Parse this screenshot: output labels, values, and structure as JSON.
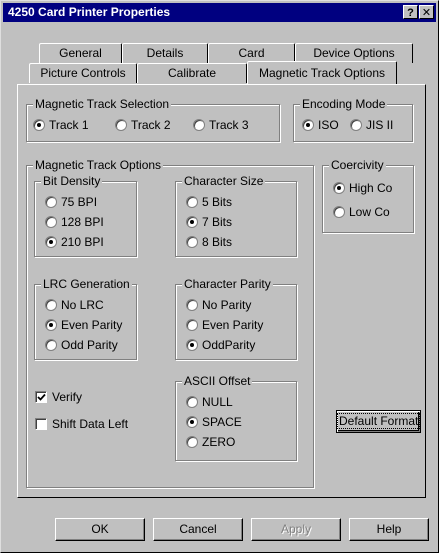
{
  "window": {
    "title": "4250 Card Printer Properties",
    "help_glyph": "?",
    "close_glyph": "✕"
  },
  "tabs_row_back": [
    {
      "label": "General"
    },
    {
      "label": "Details"
    },
    {
      "label": "Card"
    },
    {
      "label": "Device Options"
    }
  ],
  "tabs_row_front": [
    {
      "label": "Picture Controls"
    },
    {
      "label": "Calibrate"
    },
    {
      "label": "Magnetic Track Options",
      "active": true
    }
  ],
  "track_selection": {
    "title": "Magnetic Track Selection",
    "options": [
      {
        "label": "Track 1",
        "selected": true
      },
      {
        "label": "Track 2"
      },
      {
        "label": "Track 3"
      }
    ]
  },
  "encoding_mode": {
    "title": "Encoding Mode",
    "options": [
      {
        "label": "ISO",
        "selected": true
      },
      {
        "label": "JIS II"
      }
    ]
  },
  "track_options": {
    "title": "Magnetic Track Options",
    "bit_density": {
      "title": "Bit Density",
      "options": [
        {
          "label": "75 BPI"
        },
        {
          "label": "128 BPI"
        },
        {
          "label": "210 BPI",
          "selected": true
        }
      ]
    },
    "character_size": {
      "title": "Character Size",
      "options": [
        {
          "label": "5 Bits"
        },
        {
          "label": "7 Bits",
          "selected": true
        },
        {
          "label": "8 Bits"
        }
      ]
    },
    "lrc_generation": {
      "title": "LRC Generation",
      "options": [
        {
          "label": "No LRC"
        },
        {
          "label": "Even Parity",
          "selected": true
        },
        {
          "label": "Odd Parity"
        }
      ]
    },
    "character_parity": {
      "title": "Character Parity",
      "options": [
        {
          "label": "No Parity"
        },
        {
          "label": "Even Parity"
        },
        {
          "label": "OddParity",
          "selected": true
        }
      ]
    },
    "verify": {
      "label": "Verify",
      "checked": true
    },
    "shift_data_left": {
      "label": "Shift Data Left",
      "checked": false
    },
    "ascii_offset": {
      "title": "ASCII Offset",
      "options": [
        {
          "label": "NULL"
        },
        {
          "label": "SPACE",
          "selected": true
        },
        {
          "label": "ZERO"
        }
      ]
    }
  },
  "coercivity": {
    "title": "Coercivity",
    "options": [
      {
        "label": "High Co",
        "selected": true
      },
      {
        "label": "Low Co"
      }
    ]
  },
  "default_format_button": "Default Format",
  "footer_buttons": {
    "ok": "OK",
    "cancel": "Cancel",
    "apply": "Apply",
    "help": "Help"
  },
  "colors": {
    "face": "#c0c0c0",
    "title_bar": "#000080",
    "shadow": "#808080",
    "highlight": "#ffffff"
  }
}
